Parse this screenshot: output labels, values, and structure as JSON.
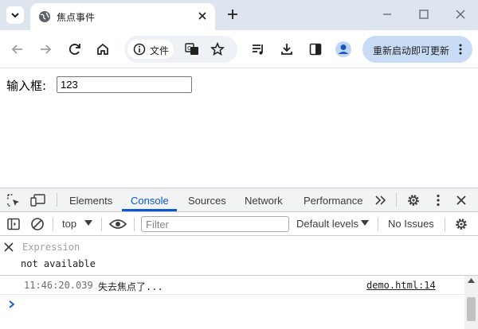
{
  "browser": {
    "tab_title": "焦点事件",
    "address_chip": "文件",
    "update_button": "重新启动即可更新",
    "accent": "#0b57d0"
  },
  "page": {
    "label": "输入框:",
    "input_value": "123"
  },
  "devtools": {
    "tabs": [
      "Elements",
      "Console",
      "Sources",
      "Network",
      "Performance"
    ],
    "active_tab": "Console",
    "context": "top",
    "filter_placeholder": "Filter",
    "levels": "Default levels",
    "issues": "No Issues",
    "expression_placeholder": "Expression",
    "expression_value": "not available",
    "log": {
      "time": "11:46:20.039",
      "message": "失去焦点了...",
      "source": "demo.html:14"
    }
  }
}
